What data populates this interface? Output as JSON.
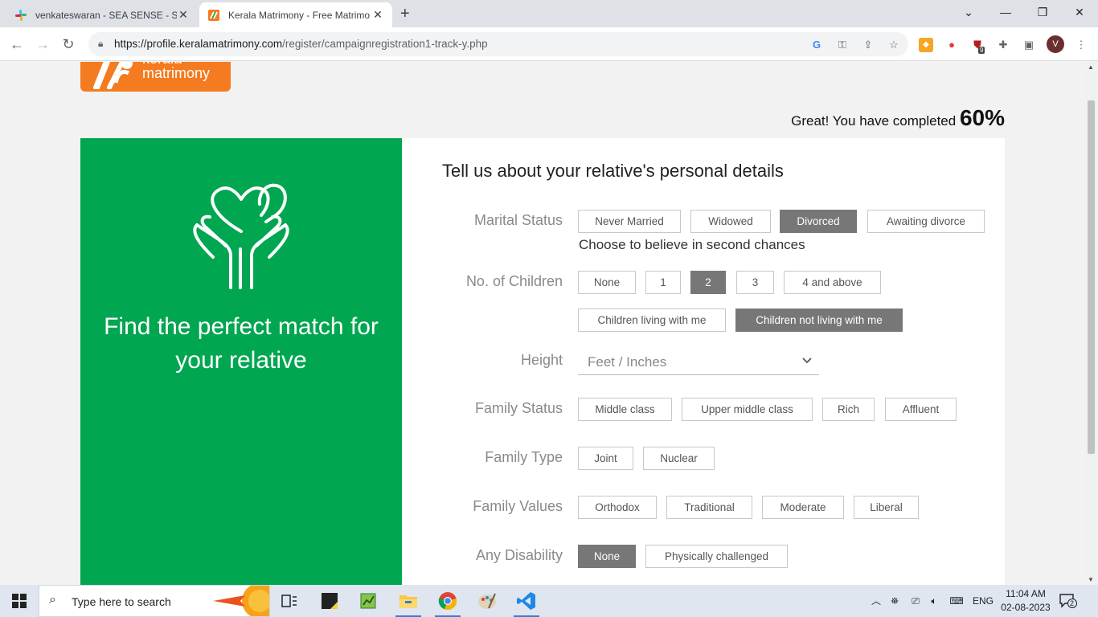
{
  "browser": {
    "tabs": [
      {
        "title": "venkateswaran - SEA SENSE - Sla"
      },
      {
        "title": "Kerala Matrimony - Free Matrimo"
      }
    ],
    "url_host": "https://profile.keralamatrimony.com",
    "url_path": "/register/campaignregistration1-track-y.php",
    "profile_initial": "V",
    "extension_badge": "9"
  },
  "logo": {
    "line1": "kerala",
    "line2": "matrimony"
  },
  "progress": {
    "text": "Great! You have completed",
    "percent": "60%",
    "value": 0.6
  },
  "promo": {
    "line1": "Find the perfect match for",
    "line2": "your relative"
  },
  "form": {
    "title": "Tell us about your relative's personal details",
    "marital_status": {
      "label": "Marital Status",
      "options": [
        "Never Married",
        "Widowed",
        "Divorced",
        "Awaiting divorce"
      ],
      "selected": "Divorced",
      "note": "Choose to believe in second chances"
    },
    "children": {
      "label": "No. of Children",
      "options": [
        "None",
        "1",
        "2",
        "3",
        "4 and above"
      ],
      "selected": "2",
      "living_options": [
        "Children living with me",
        "Children not living with me"
      ],
      "living_selected": "Children not living with me"
    },
    "height": {
      "label": "Height",
      "placeholder": "Feet / Inches"
    },
    "family_status": {
      "label": "Family Status",
      "options": [
        "Middle class",
        "Upper middle class",
        "Rich",
        "Affluent"
      ]
    },
    "family_type": {
      "label": "Family Type",
      "options": [
        "Joint",
        "Nuclear"
      ]
    },
    "family_values": {
      "label": "Family Values",
      "options": [
        "Orthodox",
        "Traditional",
        "Moderate",
        "Liberal"
      ]
    },
    "disability": {
      "label": "Any Disability",
      "options": [
        "None",
        "Physically challenged"
      ],
      "selected": "None"
    }
  },
  "taskbar": {
    "search_placeholder": "Type here to search",
    "language": "ENG",
    "time": "11:04 AM",
    "date": "02-08-2023",
    "notifications": "2"
  },
  "colors": {
    "brand_green": "#00a650",
    "brand_orange": "#f47b20",
    "selected_option": "#777777"
  }
}
